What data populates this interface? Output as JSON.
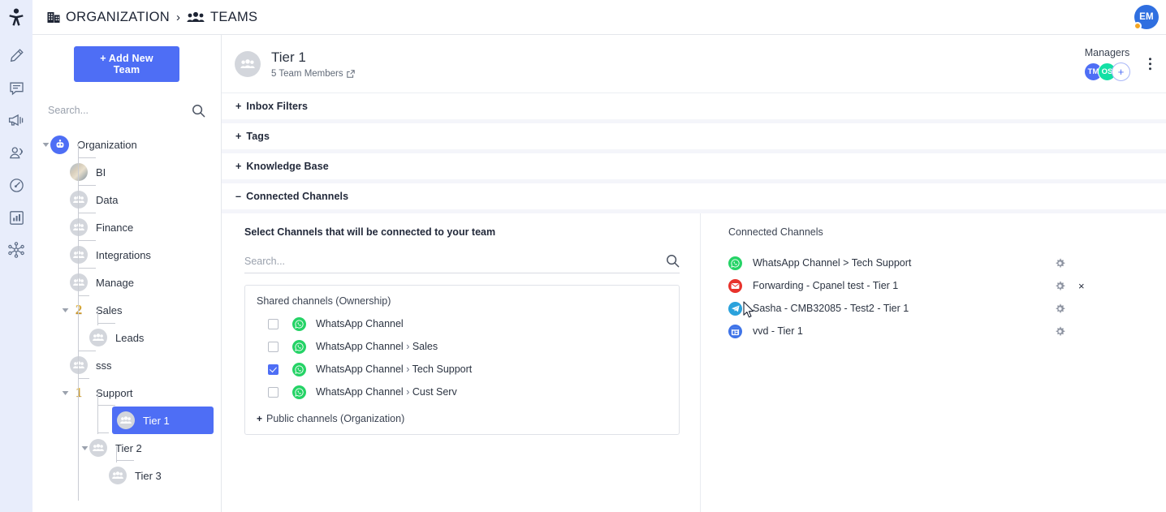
{
  "topbar": {
    "breadcrumb": {
      "org_label": "ORGANIZATION",
      "separator": "›",
      "teams_label": "TEAMS",
      "org_icon": "building-icon",
      "teams_icon": "people-group-icon"
    },
    "user_avatar": {
      "initials": "EM",
      "status": "away"
    }
  },
  "rail": {
    "items": [
      {
        "icon": "pencil-icon",
        "name": "compose"
      },
      {
        "icon": "chat-bubble-icon",
        "name": "conversations"
      },
      {
        "icon": "megaphone-icon",
        "name": "broadcast"
      },
      {
        "icon": "contacts-icon",
        "name": "contacts"
      },
      {
        "icon": "gauge-icon",
        "name": "dashboard"
      },
      {
        "icon": "bar-chart-icon",
        "name": "reports"
      },
      {
        "icon": "network-icon",
        "name": "integrations"
      }
    ]
  },
  "sidebar": {
    "add_team_label": "+ Add New Team",
    "search_placeholder": "Search...",
    "search_value": "",
    "search_icon": "search-icon",
    "tree": [
      {
        "label": "Organization",
        "level": 0,
        "icon": "org-bot-icon",
        "expanded": true,
        "selected": false
      },
      {
        "label": "BI",
        "level": 1,
        "icon": "photo-avatar",
        "expanded": null,
        "selected": false
      },
      {
        "label": "Data",
        "level": 1,
        "icon": "team-icon",
        "expanded": null,
        "selected": false
      },
      {
        "label": "Finance",
        "level": 1,
        "icon": "team-icon",
        "expanded": null,
        "selected": false
      },
      {
        "label": "Integrations",
        "level": 1,
        "icon": "team-icon",
        "expanded": null,
        "selected": false
      },
      {
        "label": "Manage",
        "level": 1,
        "icon": "team-icon",
        "expanded": null,
        "selected": false
      },
      {
        "label": "Sales",
        "level": 1,
        "icon": "rank-badge",
        "badge": "2",
        "expanded": true,
        "selected": false
      },
      {
        "label": "Leads",
        "level": 2,
        "icon": "team-icon",
        "expanded": null,
        "selected": false
      },
      {
        "label": "sss",
        "level": 1,
        "icon": "team-icon",
        "expanded": null,
        "selected": false
      },
      {
        "label": "Support",
        "level": 1,
        "icon": "rank-badge",
        "badge": "1",
        "expanded": true,
        "selected": false
      },
      {
        "label": "Tier 1",
        "level": 2,
        "icon": "team-icon",
        "expanded": null,
        "selected": true
      },
      {
        "label": "Tier 2",
        "level": 2,
        "icon": "team-icon",
        "expanded": true,
        "selected": false
      },
      {
        "label": "Tier 3",
        "level": 3,
        "icon": "team-icon",
        "expanded": null,
        "selected": false
      }
    ]
  },
  "main": {
    "team": {
      "name": "Tier 1",
      "members_text": "5 Team Members",
      "members_link_icon": "external-link-icon",
      "avatar_icon": "team-icon"
    },
    "managers": {
      "label": "Managers",
      "chips": [
        {
          "initials": "TM",
          "color": "#4e6ef5"
        },
        {
          "initials": "OS",
          "color": "#13e0a5"
        }
      ],
      "add_label": "+"
    },
    "kebab_icon": "more-vertical-icon",
    "sections": [
      {
        "label": "Inbox Filters",
        "sign": "+",
        "expanded": false
      },
      {
        "label": "Tags",
        "sign": "+",
        "expanded": false
      },
      {
        "label": "Knowledge Base",
        "sign": "+",
        "expanded": false
      },
      {
        "label": "Connected Channels",
        "sign": "–",
        "expanded": true
      }
    ],
    "select_panel": {
      "title": "Select Channels that will be connected to your team",
      "search_placeholder": "Search...",
      "search_value": "",
      "search_icon": "search-icon",
      "group_title": "Shared channels (Ownership)",
      "options": [
        {
          "label": "WhatsApp Channel",
          "sub": "",
          "icon": "whatsapp-icon",
          "checked": false
        },
        {
          "label": "WhatsApp Channel",
          "sub": "Sales",
          "icon": "whatsapp-icon",
          "checked": false
        },
        {
          "label": "WhatsApp Channel",
          "sub": "Tech Support",
          "icon": "whatsapp-icon",
          "checked": true
        },
        {
          "label": "WhatsApp Channel",
          "sub": "Cust Serv",
          "icon": "whatsapp-icon",
          "checked": false
        }
      ],
      "more_label": "Public channels (Organization)",
      "more_sign": "+"
    },
    "connected_panel": {
      "title": "Connected Channels",
      "gear_icon": "gear-icon",
      "remove_icon": "close-icon",
      "items": [
        {
          "label": "WhatsApp Channel > Tech Support",
          "icon": "whatsapp-icon",
          "removable": false
        },
        {
          "label": "Forwarding - Cpanel test - Tier 1",
          "icon": "email-icon",
          "removable": true
        },
        {
          "label": "Sasha - CMB32085 - Test2 - Tier 1",
          "icon": "telegram-icon",
          "removable": false
        },
        {
          "label": "vvd - Tier 1",
          "icon": "window-icon",
          "removable": false
        }
      ]
    }
  },
  "colors": {
    "accent": "#4e6ef5",
    "rail_bg": "#e8edfb",
    "page_bg": "#f4f5fa",
    "whatsapp": "#25d366",
    "email": "#e8322b",
    "telegram": "#2aa2dc",
    "window": "#3f74e8",
    "manager_os": "#13e0a5",
    "status_dot": "#f5a623"
  }
}
